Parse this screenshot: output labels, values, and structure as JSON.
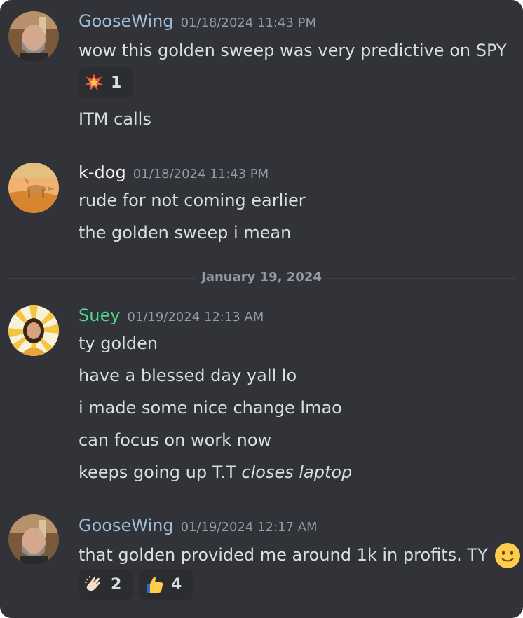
{
  "colors": {
    "gooseWing": "#9ebfdc",
    "kdog": "#f2f3f5",
    "suey": "#4fd88a",
    "background": "#313338"
  },
  "messages": [
    {
      "author": "GooseWing",
      "timestamp": "01/18/2024 11:43 PM",
      "lines": [
        "wow this golden sweep was very predictive on SPY",
        "ITM calls"
      ],
      "reactions": [
        {
          "emoji": "collision-icon",
          "count": "1"
        }
      ]
    },
    {
      "author": "k-dog",
      "timestamp": "01/18/2024 11:43 PM",
      "lines": [
        "rude for not coming earlier",
        "the golden sweep i mean"
      ]
    },
    {
      "author": "Suey",
      "timestamp": "01/19/2024 12:13 AM",
      "lines": [
        "ty golden",
        "have a blessed day yall lo",
        "i made some nice change lmao",
        "can focus on work now",
        "keeps going up T.T "
      ],
      "italic": "closes laptop"
    },
    {
      "author": "GooseWing",
      "timestamp": "01/19/2024 12:17 AM",
      "lines": [
        "that golden provided me around 1k in profits.  TY"
      ],
      "reactions": [
        {
          "emoji": "clapping-hands-icon",
          "count": "2"
        },
        {
          "emoji": "thumbs-up-icon",
          "count": "4"
        }
      ]
    }
  ],
  "divider": {
    "label": "January 19, 2024"
  }
}
